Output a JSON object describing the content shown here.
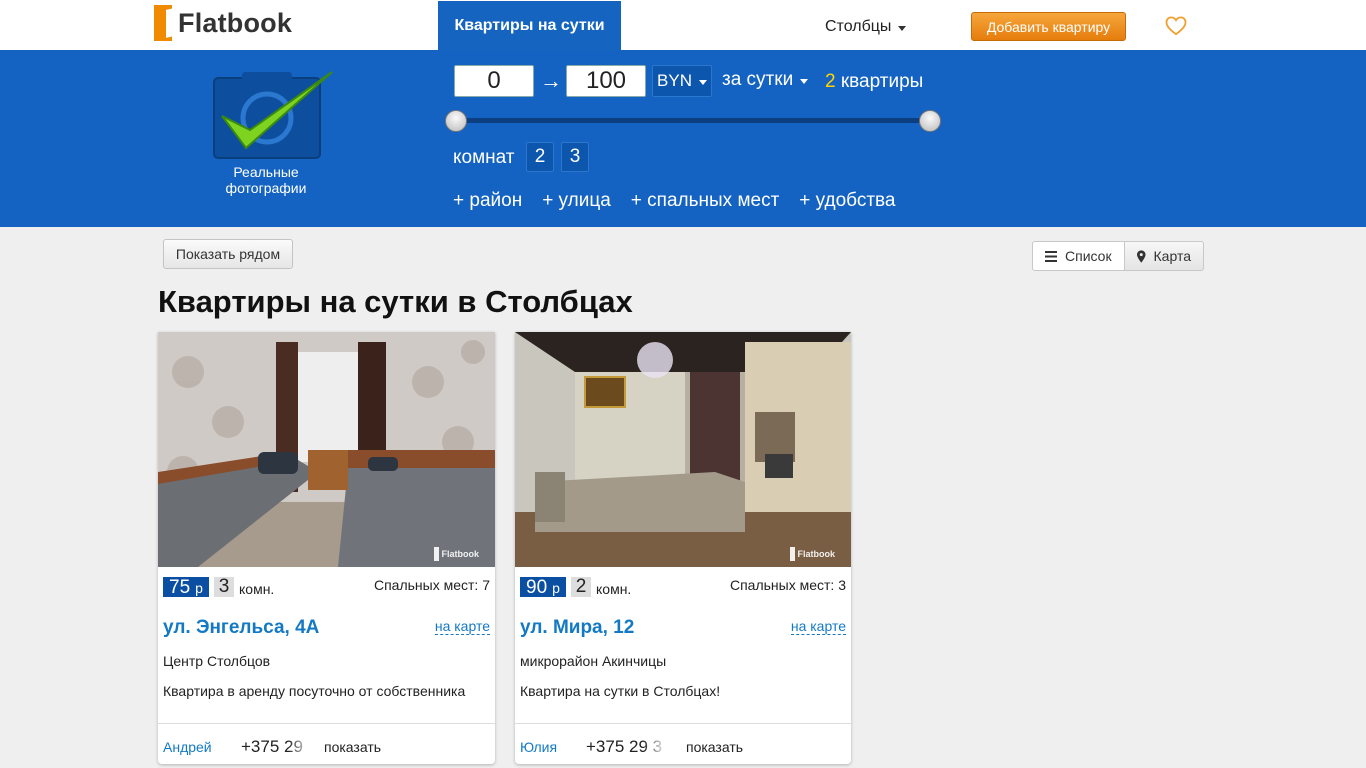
{
  "header": {
    "brand": "Flatbook",
    "nav_active": "Квартиры на сутки",
    "city": "Столбцы",
    "add_button": "Добавить квартиру",
    "favorites_icon": "heart-icon"
  },
  "filters": {
    "badge_caption": "Реальные фотографии",
    "price_min": "0",
    "arrow": "→",
    "price_max": "100",
    "currency": "BYN",
    "period": "за сутки",
    "result_count": "2",
    "result_word": "квартиры",
    "price_range_fraction": [
      0,
      1
    ],
    "rooms_label": "комнат",
    "rooms": [
      "2",
      "3"
    ],
    "extra": [
      "+ район",
      "+ улица",
      "+ спальных мест",
      "+ удобства"
    ]
  },
  "toolbar": {
    "near_button": "Показать рядом",
    "list_button": "Список",
    "map_button": "Карта"
  },
  "page_title": "Квартиры на сутки в Столбцах",
  "colors": {
    "brand_orange": "#f08a00",
    "filter_blue": "#1463c2",
    "link_blue": "#1479c4",
    "price_blue": "#0b4fa3"
  },
  "listings": [
    {
      "price": "75",
      "price_unit": "р",
      "rooms": "3",
      "rooms_word": "комн.",
      "beds": "Спальных мест: 7",
      "street": "ул. Энгельса, 4А",
      "on_map": "на карте",
      "district": "Центр Столбцов",
      "description": "Квартира в аренду посуточно от собственника",
      "owner": "Андрей",
      "phone": "+375 29",
      "show": "показать",
      "watermark": "Flatbook"
    },
    {
      "price": "90",
      "price_unit": "р",
      "rooms": "2",
      "rooms_word": "комн.",
      "beds": "Спальных мест: 3",
      "street": "ул. Мира, 12",
      "on_map": "на карте",
      "district": "микрорайон Акинчицы",
      "description": "Квартира на сутки в Столбцах!",
      "owner": "Юлия",
      "phone": "+375 29 3",
      "show": "показать",
      "watermark": "Flatbook"
    }
  ]
}
